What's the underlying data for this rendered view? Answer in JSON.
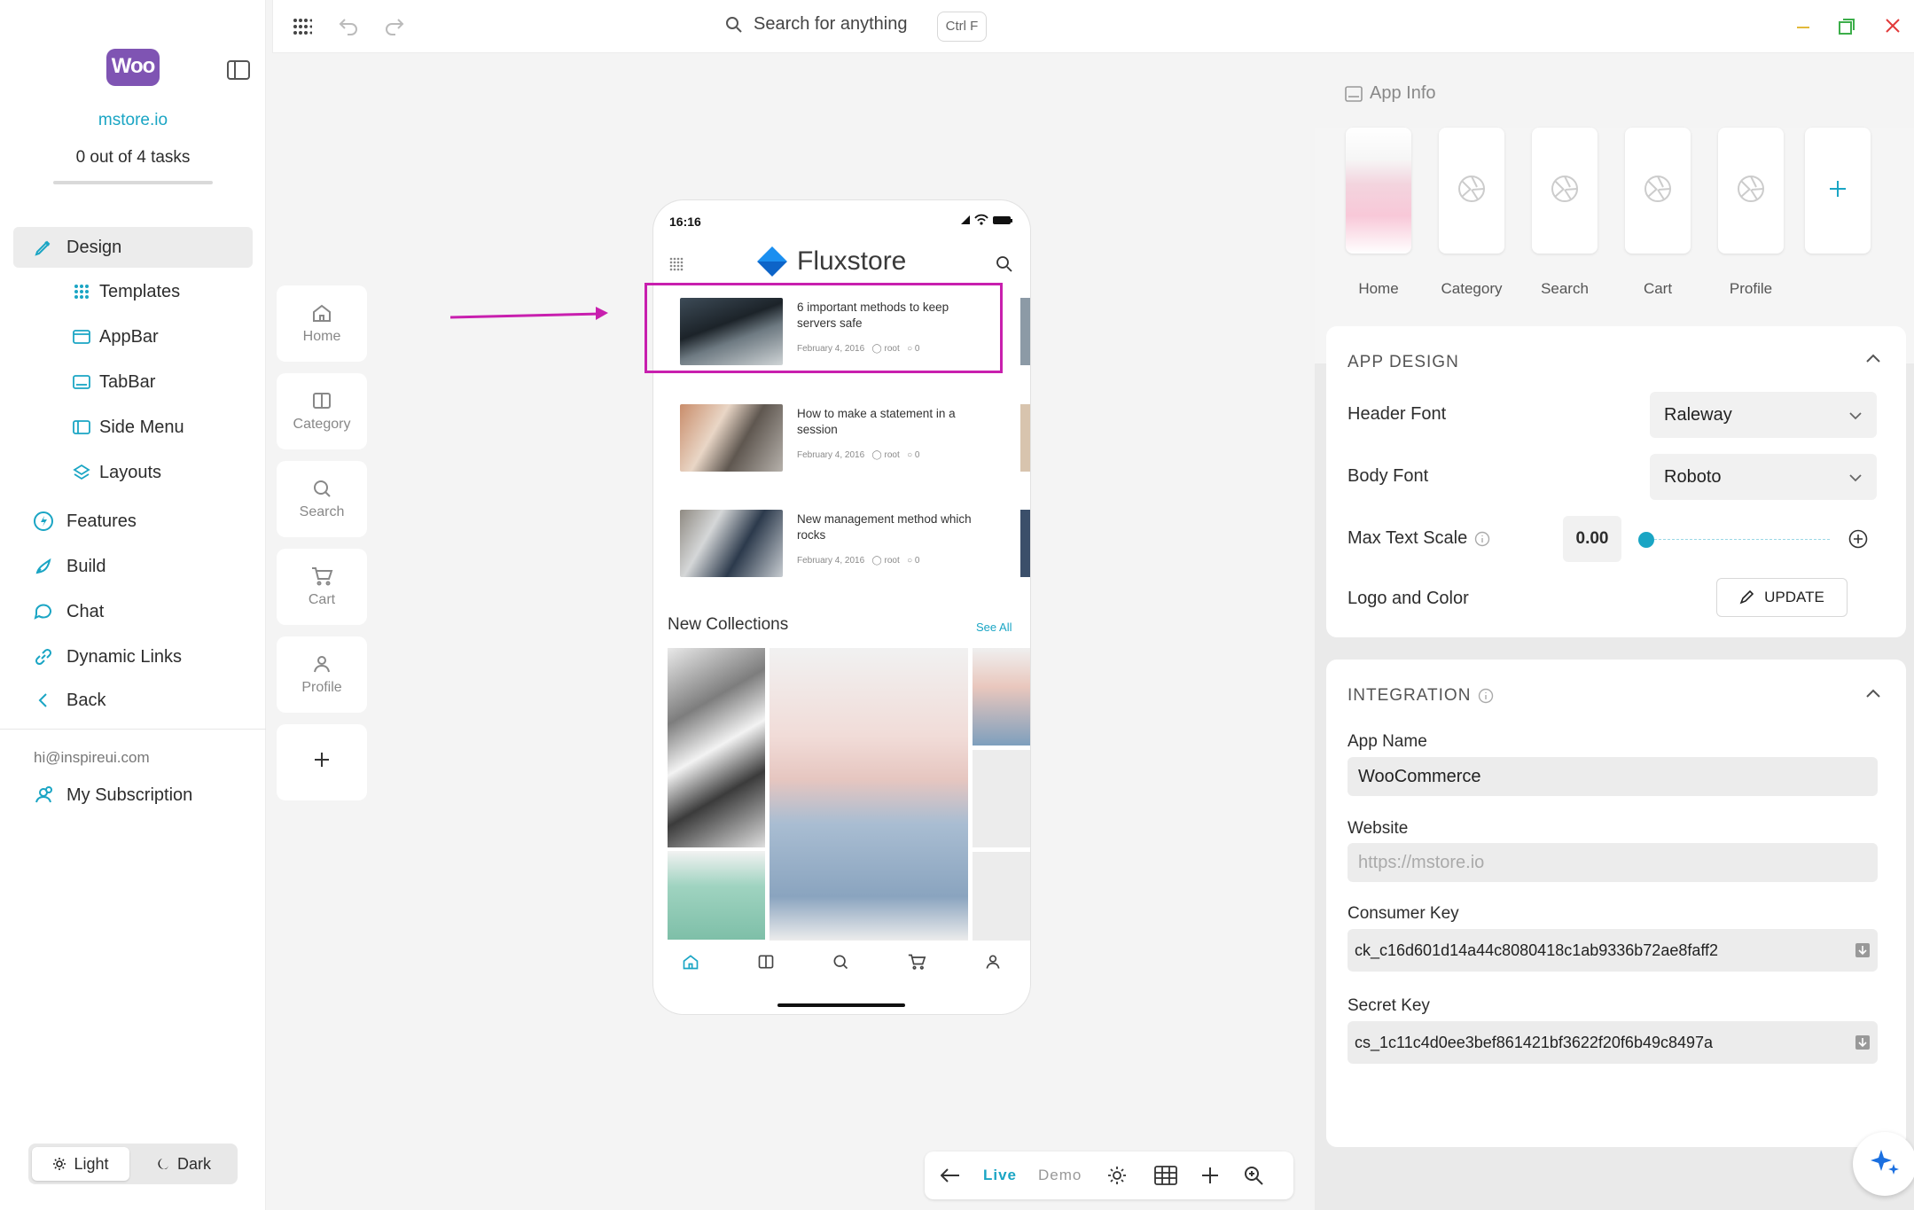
{
  "sidebar": {
    "logo_text": "Woo",
    "store_name": "mstore.io",
    "tasks": "0 out of 4 tasks",
    "progress": 0,
    "nav": [
      {
        "label": "Design",
        "icon": "brush-icon",
        "active": true
      },
      {
        "label": "Features",
        "icon": "bolt-icon"
      },
      {
        "label": "Build",
        "icon": "rocket-icon"
      },
      {
        "label": "Chat",
        "icon": "chat-icon"
      },
      {
        "label": "Dynamic Links",
        "icon": "link-icon"
      },
      {
        "label": "Back",
        "icon": "chevron-left-icon"
      }
    ],
    "design_sub": [
      {
        "label": "Templates",
        "icon": "grid-icon"
      },
      {
        "label": "AppBar",
        "icon": "appbar-icon"
      },
      {
        "label": "TabBar",
        "icon": "tabbar-icon"
      },
      {
        "label": "Side Menu",
        "icon": "side-menu-icon"
      },
      {
        "label": "Layouts",
        "icon": "layers-icon"
      }
    ],
    "email": "hi@inspireui.com",
    "subscription": "My Subscription",
    "theme": {
      "light": "Light",
      "dark": "Dark",
      "selected": "Light"
    }
  },
  "topbar": {
    "search_placeholder": "Search for anything",
    "shortcut": "Ctrl F"
  },
  "screen_tabs": [
    "Home",
    "Category",
    "Search",
    "Cart",
    "Profile"
  ],
  "phone": {
    "time": "16:16",
    "brand": "Fluxstore",
    "posts": [
      {
        "title": "6 important methods to keep servers safe",
        "date": "February 4, 2016",
        "author": "root",
        "comments": "0"
      },
      {
        "title": "How to make a statement in a session",
        "date": "February 4, 2016",
        "author": "root",
        "comments": "0"
      },
      {
        "title": "New management method which rocks",
        "date": "February 4, 2016",
        "author": "root",
        "comments": "0"
      }
    ],
    "collections_title": "New Collections",
    "see_all": "See All"
  },
  "bottombar": {
    "live": "Live",
    "demo": "Demo",
    "mode": "Live"
  },
  "right_panel": {
    "header": "App Info",
    "screens": [
      "Home",
      "Category",
      "Search",
      "Cart",
      "Profile"
    ],
    "app_design": {
      "title": "APP DESIGN",
      "header_font_label": "Header Font",
      "header_font": "Raleway",
      "body_font_label": "Body Font",
      "body_font": "Roboto",
      "max_text_scale_label": "Max Text Scale",
      "max_text_scale": "0.00",
      "logo_color_label": "Logo and Color",
      "update_label": "UPDATE"
    },
    "integration": {
      "title": "INTEGRATION",
      "app_name_label": "App Name",
      "app_name": "WooCommerce",
      "website_label": "Website",
      "website_placeholder": "https://mstore.io",
      "consumer_key_label": "Consumer Key",
      "consumer_key": "ck_c16d601d14a44c8080418c1ab9336b72ae8faff2",
      "secret_key_label": "Secret Key",
      "secret_key": "cs_1c11c4d0ee3bef861421bf3622f20f6b49c8497a"
    }
  },
  "colors": {
    "accent": "#1aa5c4",
    "highlight": "#c81fae",
    "brand_purple": "#7f54b3"
  }
}
